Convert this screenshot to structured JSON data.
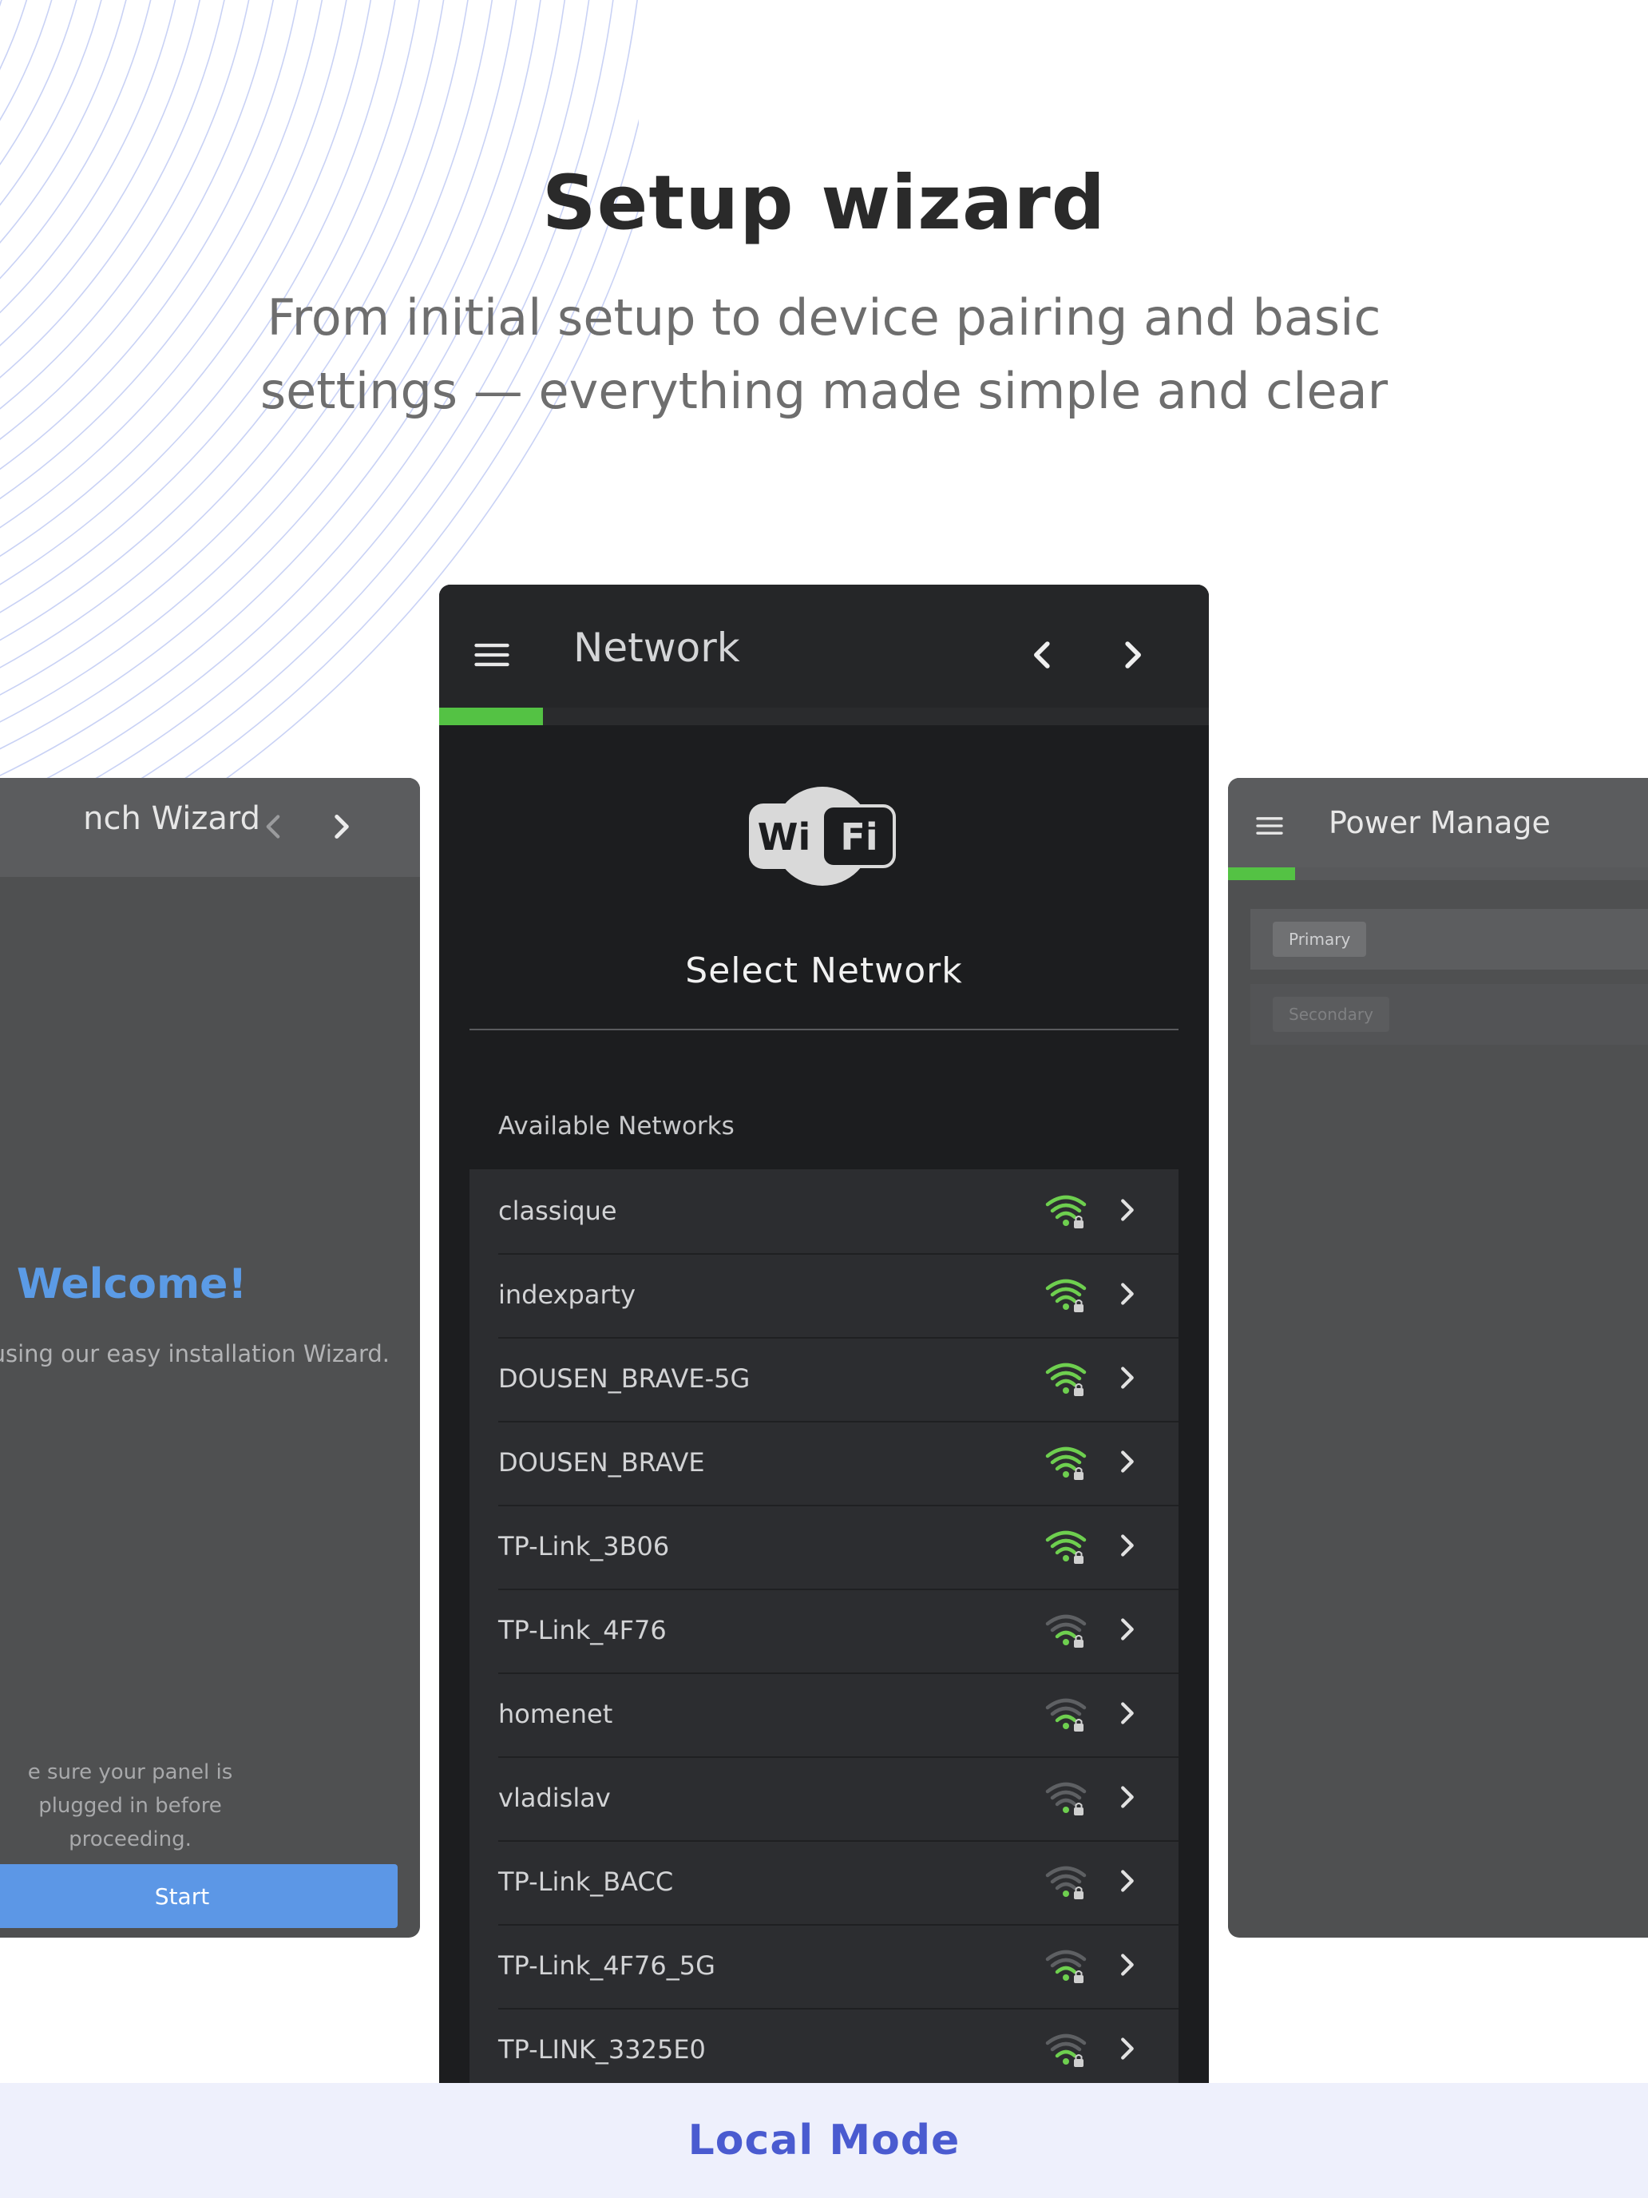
{
  "hero": {
    "title": "Setup wizard",
    "subtitle_line1": "From initial setup to device pairing and basic",
    "subtitle_line2": "settings — everything made simple and clear"
  },
  "left_panel": {
    "title": "nch Wizard",
    "welcome": "Welcome!",
    "intro": "y using our easy installation Wizard.",
    "note_line1": "e sure your panel is plugged in before",
    "note_line2": "proceeding.",
    "start_label": "Start"
  },
  "center_panel": {
    "title": "Network",
    "progress_fraction": 0.135,
    "wifi_logo_left": "Wi",
    "wifi_logo_right": "Fi",
    "select_title": "Select Network",
    "list_label": "Available Networks",
    "networks": [
      {
        "name": "classique",
        "strength": 4
      },
      {
        "name": "indexparty",
        "strength": 4
      },
      {
        "name": "DOUSEN_BRAVE-5G",
        "strength": 4
      },
      {
        "name": "DOUSEN_BRAVE",
        "strength": 4
      },
      {
        "name": "TP-Link_3B06",
        "strength": 4
      },
      {
        "name": "TP-Link_4F76",
        "strength": 2
      },
      {
        "name": "homenet",
        "strength": 2
      },
      {
        "name": "vladislav",
        "strength": 1
      },
      {
        "name": "TP-Link_BACC",
        "strength": 1
      },
      {
        "name": "TP-Link_4F76_5G",
        "strength": 2
      },
      {
        "name": "TP-LINK_3325E0",
        "strength": 2
      }
    ]
  },
  "right_panel": {
    "title": "Power Manage",
    "progress_fraction": 0.15,
    "primary_label": "Primary",
    "secondary_label": "Secondary"
  },
  "footer": {
    "label": "Local Mode"
  },
  "colors": {
    "accent_green": "#54c244",
    "signal_green": "#6ecf4f",
    "signal_dim": "#5e6063",
    "welcome_blue": "#5b9be6",
    "footer_blue": "#4a5bd0"
  }
}
